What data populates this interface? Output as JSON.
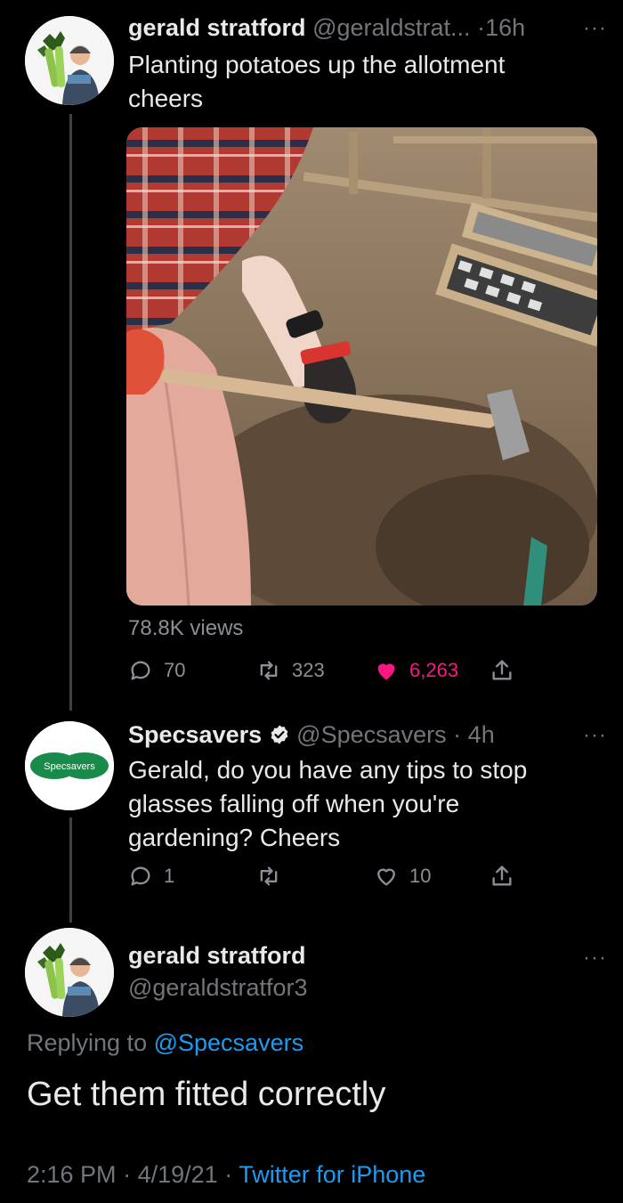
{
  "tweet1": {
    "display_name": "gerald stratford",
    "handle": "@geraldstrat...",
    "dot": "·",
    "age": "16h",
    "more": "···",
    "text_line1": "Planting potatoes up the allotment",
    "text_line2": "cheers",
    "views": "78.8K views",
    "reply_count": "70",
    "retweet_count": "323",
    "like_count": "6,263",
    "like_color": "#f91880"
  },
  "tweet2": {
    "avatar_logo": "Specsavers",
    "display_name": "Specsavers",
    "handle": "@Specsavers",
    "dot": "·",
    "age": "4h",
    "more": "···",
    "text_line1": "Gerald, do you have any tips to stop",
    "text_line2": "glasses falling off when you're",
    "text_line3": "gardening? Cheers",
    "reply_count": "1",
    "retweet_count": "",
    "like_count": "10",
    "brand_color": "#1a8a4a"
  },
  "tweet3": {
    "display_name": "gerald stratford",
    "handle": "@geraldstratfor3",
    "more": "···",
    "replying_prefix": "Replying to",
    "replying_handle": "@Specsavers",
    "text": "Get them fitted correctly",
    "time": "2:16 PM",
    "sep1": "·",
    "date": "4/19/21",
    "sep2": "·",
    "source": "Twitter for iPhone"
  },
  "icons": [
    "reply-icon",
    "retweet-icon",
    "like-icon",
    "share-icon",
    "verified-badge-icon",
    "more-icon"
  ],
  "colors": {
    "background": "#000000",
    "muted": "#71767b",
    "link": "#1d9bf0",
    "like": "#f91880"
  }
}
